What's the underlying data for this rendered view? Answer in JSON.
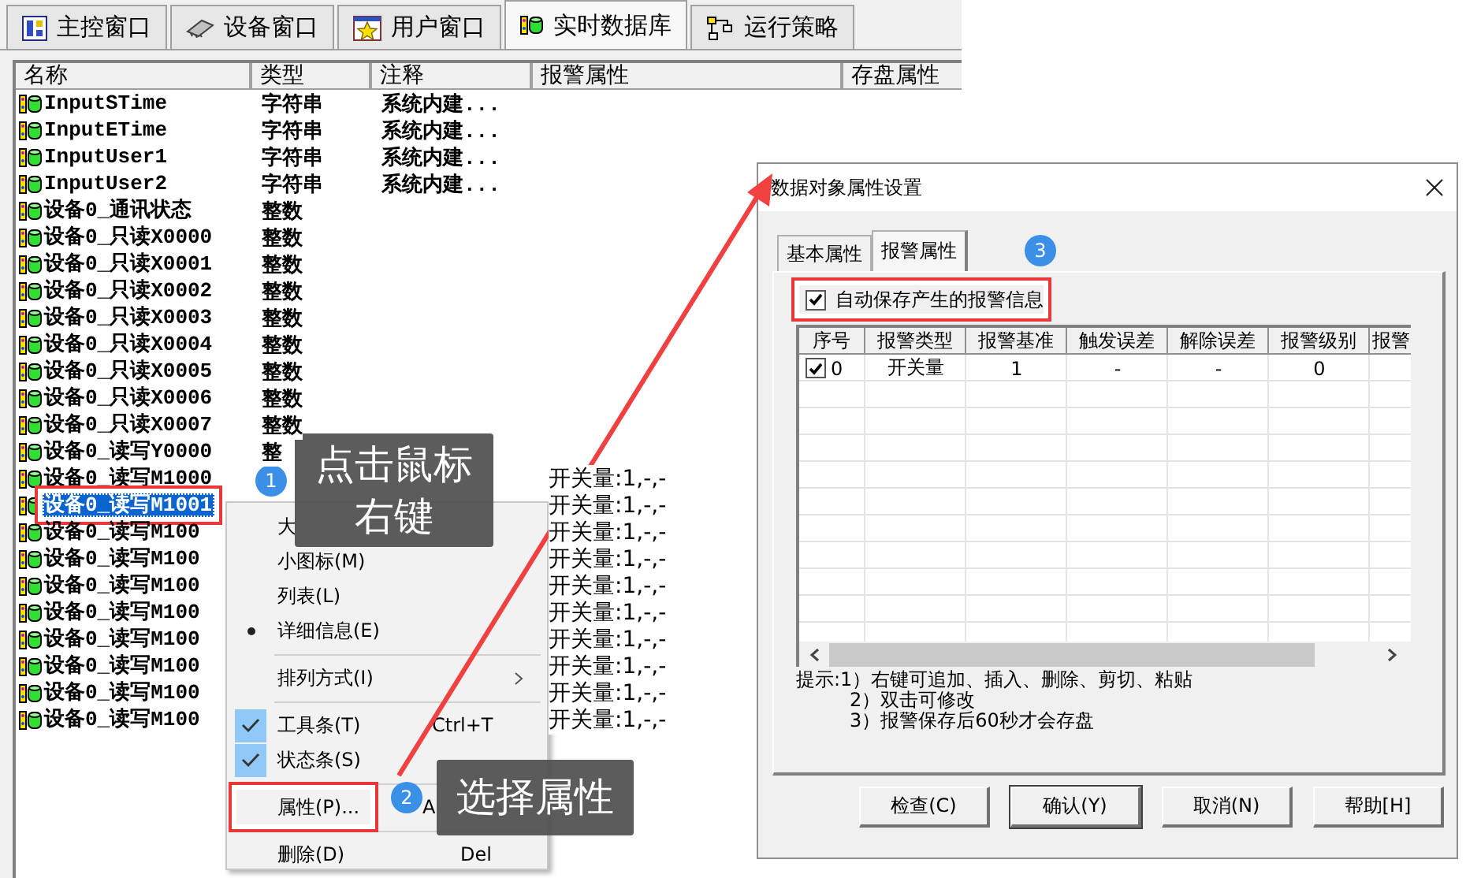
{
  "tabs": [
    {
      "label": "主控窗口",
      "selected": false
    },
    {
      "label": "设备窗口",
      "selected": false
    },
    {
      "label": "用户窗口",
      "selected": false
    },
    {
      "label": "实时数据库",
      "selected": true
    },
    {
      "label": "运行策略",
      "selected": false
    }
  ],
  "table": {
    "columns": [
      "名称",
      "类型",
      "注释",
      "报警属性",
      "存盘属性"
    ],
    "rows": [
      {
        "name": "InputSTime",
        "type": "字符串",
        "note": "系统内建...",
        "selected": false,
        "marked": false
      },
      {
        "name": "InputETime",
        "type": "字符串",
        "note": "系统内建...",
        "selected": false,
        "marked": false
      },
      {
        "name": "InputUser1",
        "type": "字符串",
        "note": "系统内建...",
        "selected": false,
        "marked": false
      },
      {
        "name": "InputUser2",
        "type": "字符串",
        "note": "系统内建...",
        "selected": false,
        "marked": false
      },
      {
        "name": "设备0_通讯状态",
        "type": "整数",
        "selected": false,
        "marked": false
      },
      {
        "name": "设备0_只读X0000",
        "type": "整数",
        "selected": false,
        "marked": false
      },
      {
        "name": "设备0_只读X0001",
        "type": "整数",
        "selected": false,
        "marked": false
      },
      {
        "name": "设备0_只读X0002",
        "type": "整数",
        "selected": false,
        "marked": false
      },
      {
        "name": "设备0_只读X0003",
        "type": "整数",
        "selected": false,
        "marked": false
      },
      {
        "name": "设备0_只读X0004",
        "type": "整数",
        "selected": false,
        "marked": false
      },
      {
        "name": "设备0_只读X0005",
        "type": "整数",
        "selected": false,
        "marked": false
      },
      {
        "name": "设备0_只读X0006",
        "type": "整数",
        "selected": false,
        "marked": false
      },
      {
        "name": "设备0_只读X0007",
        "type": "整数",
        "selected": false,
        "marked": false
      },
      {
        "name": "设备0_读写Y0000",
        "type": "整",
        "selected": false,
        "marked": false
      },
      {
        "name": "设备0_读写M1000",
        "alarm": "开关量:1,-,-",
        "selected": false,
        "marked": false
      },
      {
        "name": "设备0_读写M1001",
        "alarm": "开关量:1,-,-",
        "selected": true,
        "marked": true
      },
      {
        "name": "设备0_读写M100",
        "alarm": "开关量:1,-,-",
        "selected": false,
        "marked": false
      },
      {
        "name": "设备0_读写M100",
        "alarm": "开关量:1,-,-",
        "selected": false,
        "marked": false
      },
      {
        "name": "设备0_读写M100",
        "alarm": "开关量:1,-,-",
        "selected": false,
        "marked": false
      },
      {
        "name": "设备0_读写M100",
        "alarm": "开关量:1,-,-",
        "selected": false,
        "marked": false
      },
      {
        "name": "设备0_读写M100",
        "alarm": "开关量:1,-,-",
        "selected": false,
        "marked": false
      },
      {
        "name": "设备0_读写M100",
        "alarm": "开关量:1,-,-",
        "selected": false,
        "marked": false
      },
      {
        "name": "设备0_读写M100",
        "alarm": "开关量:1,-,-",
        "selected": false,
        "marked": false
      },
      {
        "name": "设备0_读写M100",
        "alarm": "开关量:1,-,-",
        "selected": false,
        "marked": false
      }
    ]
  },
  "context_menu": {
    "items": [
      {
        "kind": "item",
        "label": "大",
        "marked": false
      },
      {
        "kind": "item",
        "label": "小图标(M)",
        "marked": false
      },
      {
        "kind": "item",
        "label": "列表(L)",
        "marked": false
      },
      {
        "kind": "radio",
        "label": "详细信息(E)",
        "checked": true,
        "marked": false
      },
      {
        "kind": "separator"
      },
      {
        "kind": "submenu",
        "label": "排列方式(I)",
        "marked": false
      },
      {
        "kind": "separator"
      },
      {
        "kind": "check",
        "label": "工具条(T)",
        "shortcut": "Ctrl+T",
        "checked": true,
        "marked": false
      },
      {
        "kind": "check",
        "label": "状态条(S)",
        "checked": true,
        "marked": false
      },
      {
        "kind": "separator"
      },
      {
        "kind": "item",
        "label": "属性(P)...",
        "shortcut": "A",
        "marked": true
      },
      {
        "kind": "separator"
      },
      {
        "kind": "item",
        "label": "删除(D)",
        "shortcut": "Del",
        "marked": false
      }
    ]
  },
  "callouts": [
    {
      "number": "1",
      "text": "点击鼠标右键"
    },
    {
      "number": "2",
      "text": "选择属性"
    }
  ],
  "dialog": {
    "title": "数据对象属性设置",
    "tabs": [
      {
        "label": "基本属性",
        "selected": false
      },
      {
        "label": "报警属性",
        "selected": true
      }
    ],
    "step_badge": "3",
    "auto_save": {
      "label": "自动保存产生的报警信息",
      "checked": true,
      "marked": true
    },
    "alarm_table": {
      "columns": [
        "序号",
        "报警类型",
        "报警基准",
        "触发误差",
        "解除误差",
        "报警级别",
        "报警"
      ],
      "rows": [
        {
          "enabled": true,
          "cells": [
            "0",
            "开关量",
            "1",
            "-",
            "-",
            "0"
          ]
        }
      ]
    },
    "hints": [
      "提示:1）右键可追加、插入、删除、剪切、粘贴",
      "2）双击可修改",
      "3）报警保存后60秒才会存盘"
    ],
    "buttons": [
      {
        "label": "检查(C)",
        "default": false
      },
      {
        "label": "确认(Y)",
        "default": true
      },
      {
        "label": "取消(N)",
        "default": false
      },
      {
        "label": "帮助[H]",
        "default": false
      }
    ]
  }
}
